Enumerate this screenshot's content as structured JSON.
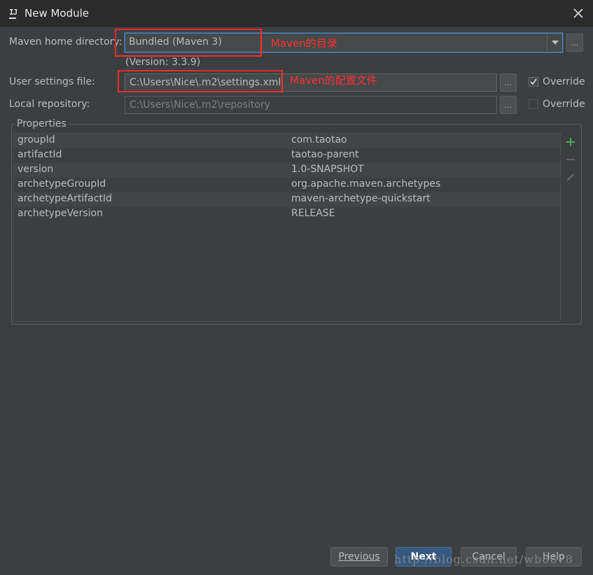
{
  "window": {
    "title": "New Module",
    "app_icon_text": "IJ"
  },
  "maven": {
    "home_label": "Maven home directory:",
    "home_value": "Bundled (Maven 3)",
    "version_text": "(Version: 3.3.9)",
    "user_settings_label": "User settings file:",
    "user_settings_value": "C:\\Users\\Nice\\.m2\\settings.xml",
    "user_settings_override": true,
    "local_repo_label": "Local repository:",
    "local_repo_value": "C:\\Users\\Nice\\.m2\\repository",
    "local_repo_override": false,
    "override_label": "Override",
    "browse_label": "..."
  },
  "annotations": {
    "home_note": "Maven的目录",
    "settings_note": "Maven的配置文件",
    "color": "#ff2a2a"
  },
  "properties": {
    "title": "Properties",
    "rows": [
      {
        "key": "groupId",
        "value": "com.taotao"
      },
      {
        "key": "artifactId",
        "value": "taotao-parent"
      },
      {
        "key": "version",
        "value": "1.0-SNAPSHOT"
      },
      {
        "key": "archetypeGroupId",
        "value": "org.apache.maven.archetypes"
      },
      {
        "key": "archetypeArtifactId",
        "value": "maven-archetype-quickstart"
      },
      {
        "key": "archetypeVersion",
        "value": "RELEASE"
      }
    ],
    "tools": [
      "add-icon",
      "remove-icon",
      "edit-icon"
    ]
  },
  "buttons": {
    "previous": "Previous",
    "next": "Next",
    "cancel": "Cancel",
    "help": "Help"
  },
  "watermark": "http://blog.csdn.net/wb8878",
  "colors": {
    "background": "#3c3f41",
    "titlebar": "#2b2b2b",
    "focus": "#4a88c7",
    "primary_button": "#365880",
    "add_green": "#4caf50"
  }
}
